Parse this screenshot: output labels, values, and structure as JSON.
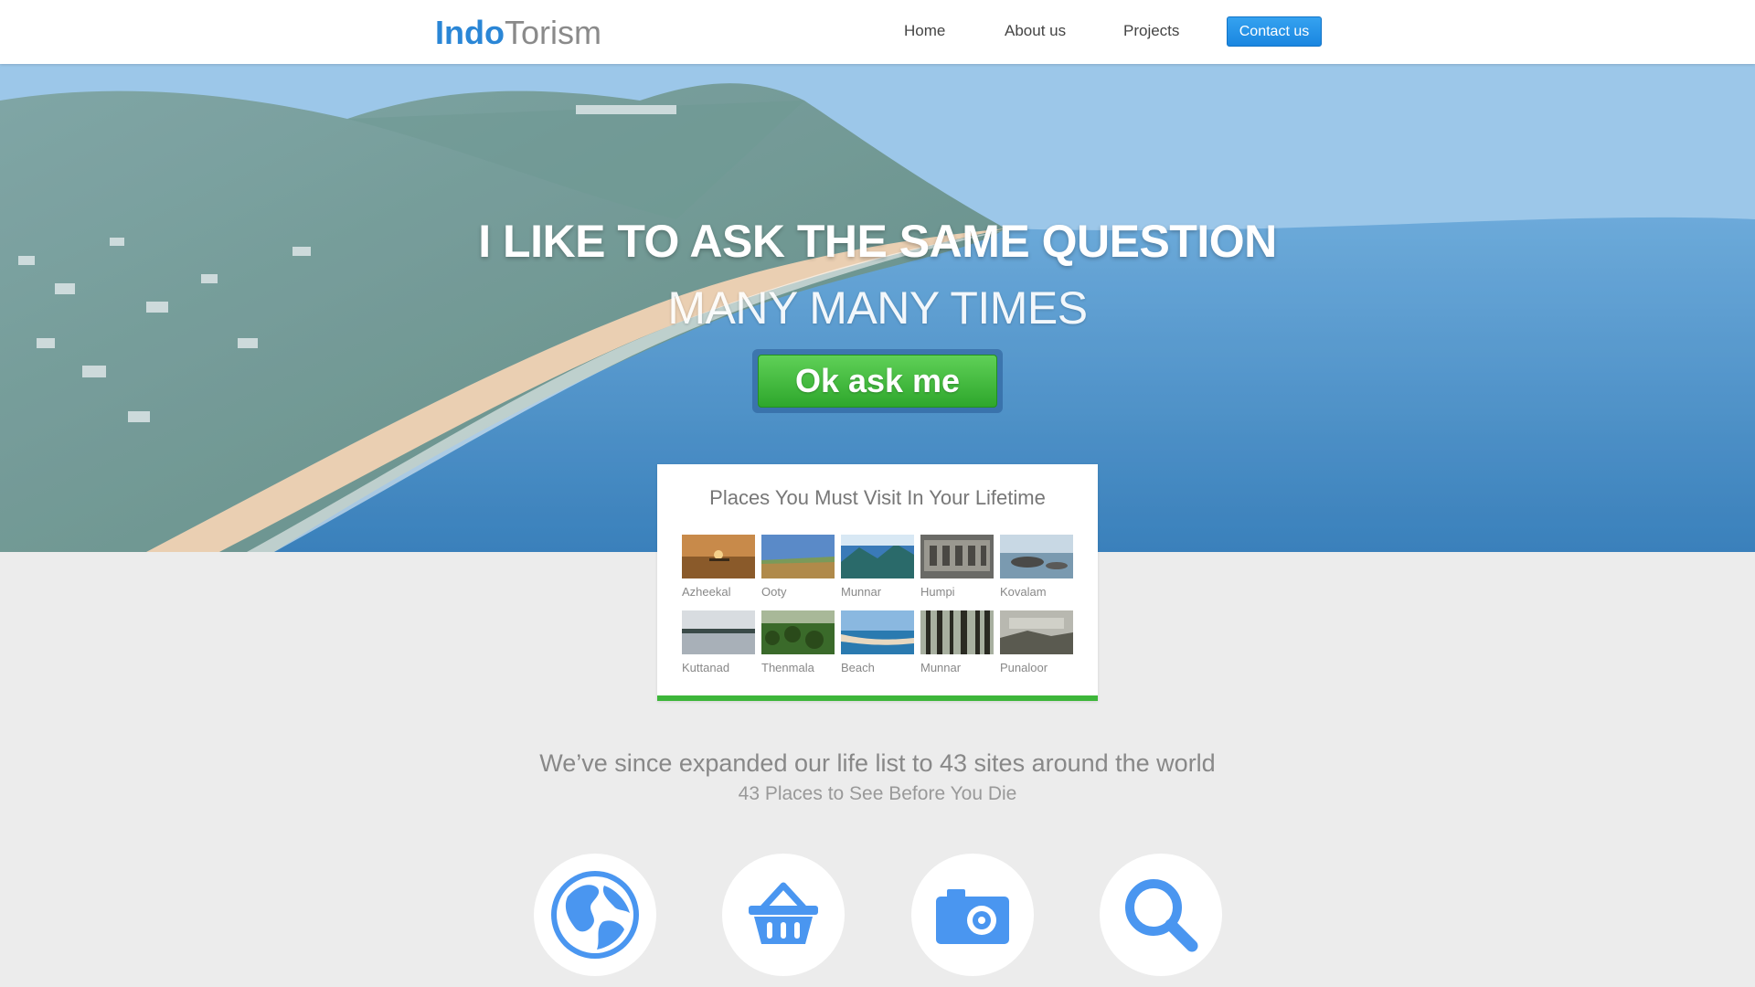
{
  "brand": {
    "bold": "Indo",
    "light": "Torism"
  },
  "nav": {
    "home": "Home",
    "about": "About us",
    "projects": "Projects",
    "contact": "Contact us"
  },
  "hero": {
    "title": "I LIKE TO ASK THE SAME QUESTION",
    "subtitle": "MANY MANY TIMES",
    "cta": "Ok ask me"
  },
  "places": {
    "title": "Places You Must Visit In Your Lifetime",
    "items": [
      {
        "label": "Azheekal"
      },
      {
        "label": "Ooty"
      },
      {
        "label": "Munnar"
      },
      {
        "label": "Humpi"
      },
      {
        "label": "Kovalam"
      },
      {
        "label": "Kuttanad"
      },
      {
        "label": "Thenmala"
      },
      {
        "label": "Beach"
      },
      {
        "label": "Munnar"
      },
      {
        "label": "Punaloor"
      }
    ]
  },
  "tagline": {
    "main": "We’ve since expanded our life list to 43 sites around the world",
    "sub": "43 Places to See Before You Die"
  },
  "features": [
    {
      "icon": "globe-icon"
    },
    {
      "icon": "basket-icon"
    },
    {
      "icon": "camera-icon"
    },
    {
      "icon": "search-icon"
    }
  ],
  "colors": {
    "brand_blue": "#2a86d6",
    "cta_green": "#3db63a",
    "icon_blue": "#4a96f0",
    "page_bg": "#ececec"
  }
}
